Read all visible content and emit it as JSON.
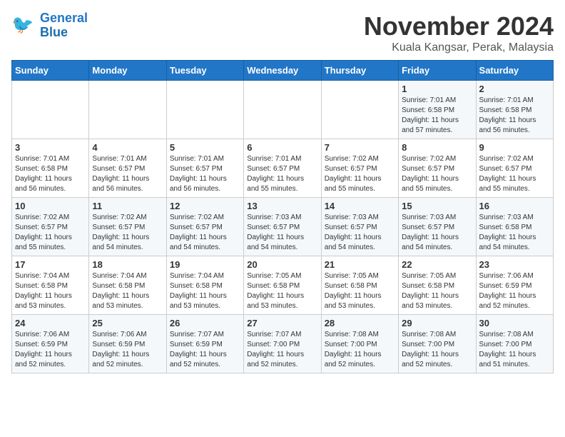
{
  "header": {
    "logo_line1": "General",
    "logo_line2": "Blue",
    "month": "November 2024",
    "location": "Kuala Kangsar, Perak, Malaysia"
  },
  "weekdays": [
    "Sunday",
    "Monday",
    "Tuesday",
    "Wednesday",
    "Thursday",
    "Friday",
    "Saturday"
  ],
  "weeks": [
    [
      {
        "day": "",
        "info": ""
      },
      {
        "day": "",
        "info": ""
      },
      {
        "day": "",
        "info": ""
      },
      {
        "day": "",
        "info": ""
      },
      {
        "day": "",
        "info": ""
      },
      {
        "day": "1",
        "info": "Sunrise: 7:01 AM\nSunset: 6:58 PM\nDaylight: 11 hours\nand 57 minutes."
      },
      {
        "day": "2",
        "info": "Sunrise: 7:01 AM\nSunset: 6:58 PM\nDaylight: 11 hours\nand 56 minutes."
      }
    ],
    [
      {
        "day": "3",
        "info": "Sunrise: 7:01 AM\nSunset: 6:58 PM\nDaylight: 11 hours\nand 56 minutes."
      },
      {
        "day": "4",
        "info": "Sunrise: 7:01 AM\nSunset: 6:57 PM\nDaylight: 11 hours\nand 56 minutes."
      },
      {
        "day": "5",
        "info": "Sunrise: 7:01 AM\nSunset: 6:57 PM\nDaylight: 11 hours\nand 56 minutes."
      },
      {
        "day": "6",
        "info": "Sunrise: 7:01 AM\nSunset: 6:57 PM\nDaylight: 11 hours\nand 55 minutes."
      },
      {
        "day": "7",
        "info": "Sunrise: 7:02 AM\nSunset: 6:57 PM\nDaylight: 11 hours\nand 55 minutes."
      },
      {
        "day": "8",
        "info": "Sunrise: 7:02 AM\nSunset: 6:57 PM\nDaylight: 11 hours\nand 55 minutes."
      },
      {
        "day": "9",
        "info": "Sunrise: 7:02 AM\nSunset: 6:57 PM\nDaylight: 11 hours\nand 55 minutes."
      }
    ],
    [
      {
        "day": "10",
        "info": "Sunrise: 7:02 AM\nSunset: 6:57 PM\nDaylight: 11 hours\nand 55 minutes."
      },
      {
        "day": "11",
        "info": "Sunrise: 7:02 AM\nSunset: 6:57 PM\nDaylight: 11 hours\nand 54 minutes."
      },
      {
        "day": "12",
        "info": "Sunrise: 7:02 AM\nSunset: 6:57 PM\nDaylight: 11 hours\nand 54 minutes."
      },
      {
        "day": "13",
        "info": "Sunrise: 7:03 AM\nSunset: 6:57 PM\nDaylight: 11 hours\nand 54 minutes."
      },
      {
        "day": "14",
        "info": "Sunrise: 7:03 AM\nSunset: 6:57 PM\nDaylight: 11 hours\nand 54 minutes."
      },
      {
        "day": "15",
        "info": "Sunrise: 7:03 AM\nSunset: 6:57 PM\nDaylight: 11 hours\nand 54 minutes."
      },
      {
        "day": "16",
        "info": "Sunrise: 7:03 AM\nSunset: 6:58 PM\nDaylight: 11 hours\nand 54 minutes."
      }
    ],
    [
      {
        "day": "17",
        "info": "Sunrise: 7:04 AM\nSunset: 6:58 PM\nDaylight: 11 hours\nand 53 minutes."
      },
      {
        "day": "18",
        "info": "Sunrise: 7:04 AM\nSunset: 6:58 PM\nDaylight: 11 hours\nand 53 minutes."
      },
      {
        "day": "19",
        "info": "Sunrise: 7:04 AM\nSunset: 6:58 PM\nDaylight: 11 hours\nand 53 minutes."
      },
      {
        "day": "20",
        "info": "Sunrise: 7:05 AM\nSunset: 6:58 PM\nDaylight: 11 hours\nand 53 minutes."
      },
      {
        "day": "21",
        "info": "Sunrise: 7:05 AM\nSunset: 6:58 PM\nDaylight: 11 hours\nand 53 minutes."
      },
      {
        "day": "22",
        "info": "Sunrise: 7:05 AM\nSunset: 6:58 PM\nDaylight: 11 hours\nand 53 minutes."
      },
      {
        "day": "23",
        "info": "Sunrise: 7:06 AM\nSunset: 6:59 PM\nDaylight: 11 hours\nand 52 minutes."
      }
    ],
    [
      {
        "day": "24",
        "info": "Sunrise: 7:06 AM\nSunset: 6:59 PM\nDaylight: 11 hours\nand 52 minutes."
      },
      {
        "day": "25",
        "info": "Sunrise: 7:06 AM\nSunset: 6:59 PM\nDaylight: 11 hours\nand 52 minutes."
      },
      {
        "day": "26",
        "info": "Sunrise: 7:07 AM\nSunset: 6:59 PM\nDaylight: 11 hours\nand 52 minutes."
      },
      {
        "day": "27",
        "info": "Sunrise: 7:07 AM\nSunset: 7:00 PM\nDaylight: 11 hours\nand 52 minutes."
      },
      {
        "day": "28",
        "info": "Sunrise: 7:08 AM\nSunset: 7:00 PM\nDaylight: 11 hours\nand 52 minutes."
      },
      {
        "day": "29",
        "info": "Sunrise: 7:08 AM\nSunset: 7:00 PM\nDaylight: 11 hours\nand 52 minutes."
      },
      {
        "day": "30",
        "info": "Sunrise: 7:08 AM\nSunset: 7:00 PM\nDaylight: 11 hours\nand 51 minutes."
      }
    ]
  ]
}
